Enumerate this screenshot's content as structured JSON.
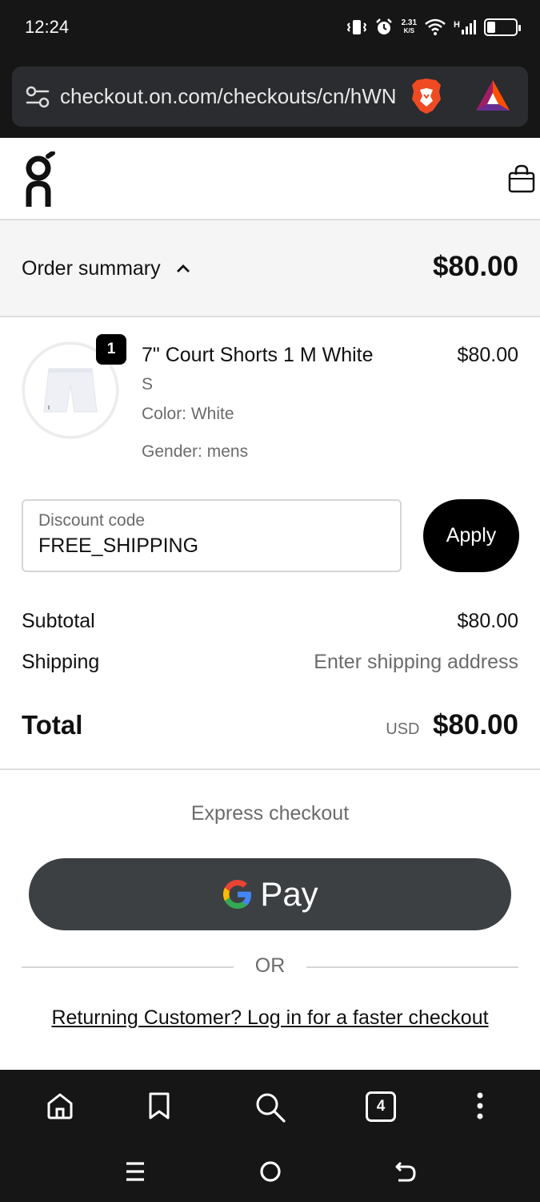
{
  "status_bar": {
    "time": "12:24",
    "net_speed_value": "2.31",
    "net_speed_unit": "K/S",
    "signal_label": "H",
    "battery": "38",
    "battery_level": 0.38
  },
  "browser": {
    "url": "checkout.on.com/checkouts/cn/hWN",
    "tab_count": "4"
  },
  "header": {
    "logo_icon": "on-logo",
    "cart_icon": "shopping-bag-icon"
  },
  "order_summary": {
    "label": "Order summary",
    "total": "$80.00"
  },
  "line_item": {
    "quantity": "1",
    "name": "7\" Court Shorts 1 M White",
    "price": "$80.00",
    "size": "S",
    "color": "Color: White",
    "gender": "Gender: mens"
  },
  "discount": {
    "placeholder": "Discount code",
    "value": "FREE_SHIPPING",
    "apply_label": "Apply"
  },
  "totals": {
    "subtotal_label": "Subtotal",
    "subtotal_value": "$80.00",
    "shipping_label": "Shipping",
    "shipping_value": "Enter shipping address",
    "total_label": "Total",
    "currency": "USD",
    "total_value": "$80.00"
  },
  "express": {
    "title": "Express checkout",
    "gpay_label": "Pay",
    "or_label": "OR",
    "login_link": "Returning Customer? Log in for a faster checkout"
  },
  "colors": {
    "gpay_bg": "#3c4043",
    "accent": "#000000",
    "muted_text": "#6b6b6b"
  }
}
